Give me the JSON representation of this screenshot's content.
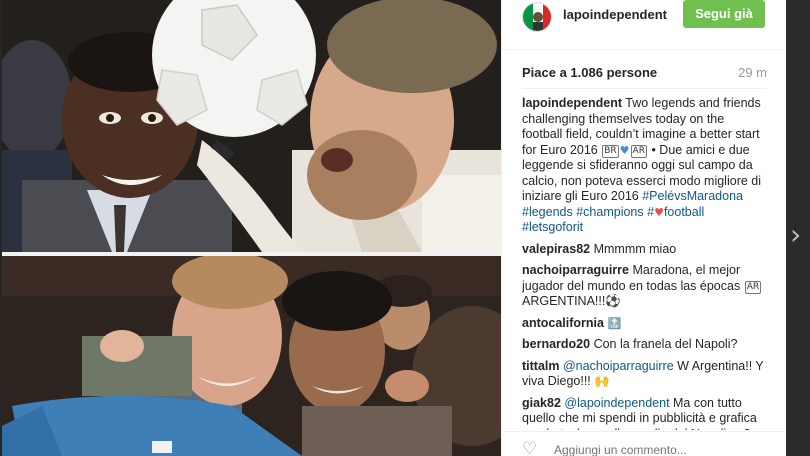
{
  "post": {
    "username": "lapoindependent",
    "follow_label": "Segui già",
    "likes": "Piace a 1.086 persone",
    "time": "29 m",
    "caption": {
      "author": "lapoindependent",
      "text_1": "Two legends and friends challenging themselves today on the football field, couldn’t imagine a better start for Euro 2016",
      "flag_br": "BR",
      "flag_ar": "AR",
      "text_2": " • Due amici e due leggende si sfideranno oggi sul campo da calcio, non poteva esserci modo migliore di iniziare gli Euro 2016 ",
      "tag_1": "#PelévsMaradona",
      "tag_2": "#legends",
      "tag_3": "#champions",
      "tag_4": "#",
      "text_3": "football",
      "tag_5": "#letsgoforit"
    },
    "comments": [
      {
        "author": "valepiras82",
        "text": "Mmmmm miao"
      },
      {
        "author": "nachoiparraguirre",
        "text": "Maradona, el mejor jugador del mundo en todas las épocas",
        "flag": "AR",
        "text_after": " ARGENTINA!!!⚽"
      },
      {
        "author": "antocalifornia",
        "text": "🔝"
      },
      {
        "author": "bernardo20",
        "text": "Con la franela del Napoli?"
      },
      {
        "author": "tittalm",
        "mention": "@nachoiparraguirre",
        "text": " W Argentina!! Y viva Diego!!! 🙌"
      },
      {
        "author": "giak82",
        "mention": "@lapoindependent",
        "text": " Ma con tutto quello che mi spendi in pubblicità e grafica un photoshop sulla maglia del Napoli no?"
      }
    ],
    "comment_placeholder": "Aggiungi un commento...",
    "next_arrow": "›"
  },
  "colors": {
    "follow_green": "#70c050",
    "link_blue": "#125688",
    "heart_red": "#ed4956"
  },
  "icons": [
    "heart-icon",
    "chevron-right-icon",
    "avatar-flag-icon"
  ]
}
